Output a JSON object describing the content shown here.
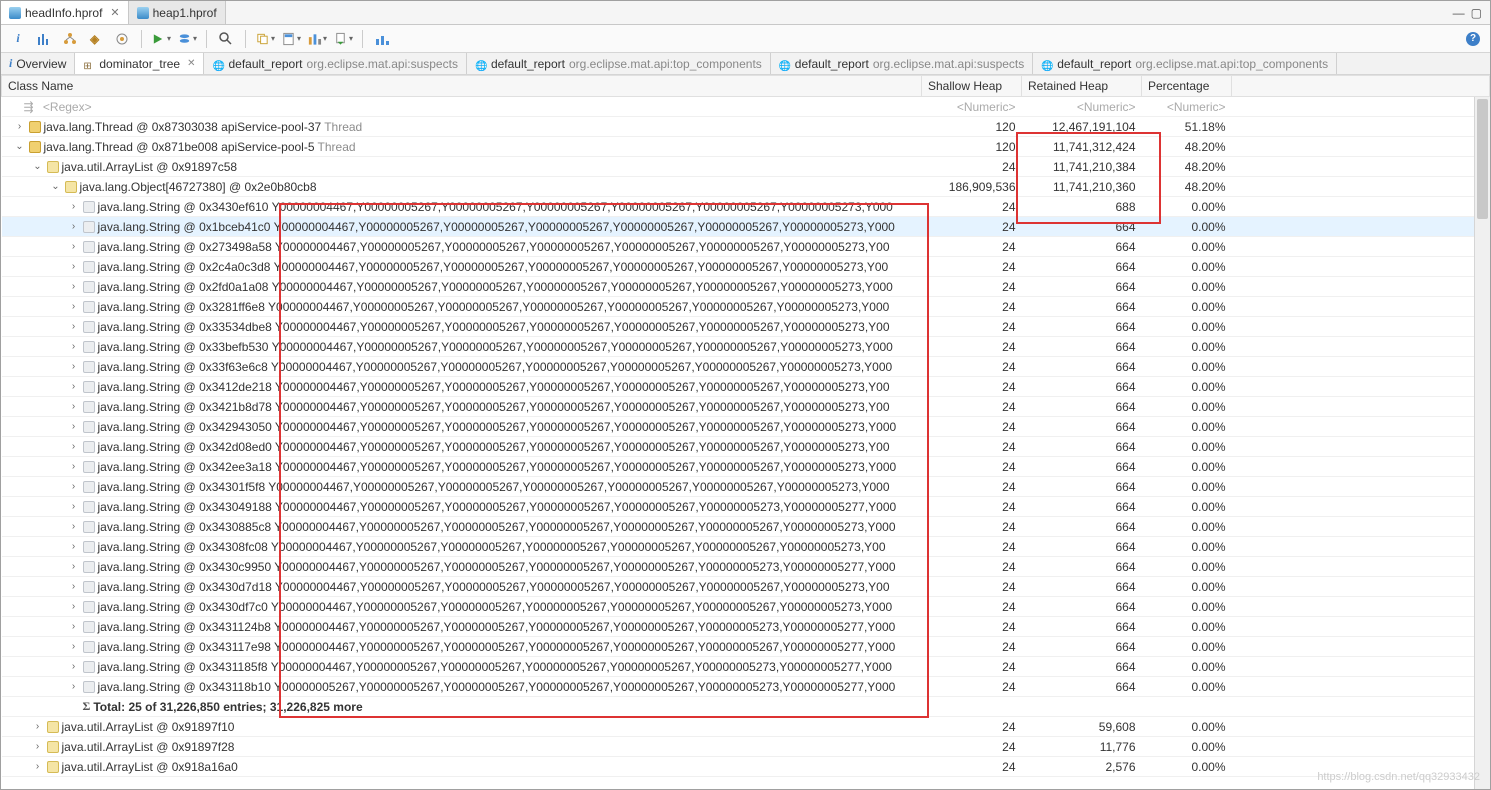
{
  "editorTabs": [
    {
      "label": "heap1.hprof",
      "active": false
    },
    {
      "label": "headInfo.hprof",
      "active": true
    }
  ],
  "subTabs": [
    {
      "icon": "info",
      "label": "Overview",
      "active": false
    },
    {
      "icon": "tree",
      "label": "dominator_tree",
      "active": true
    },
    {
      "icon": "globe",
      "label": "default_report",
      "scope": "org.eclipse.mat.api:suspects",
      "active": false
    },
    {
      "icon": "globe",
      "label": "default_report",
      "scope": "org.eclipse.mat.api:top_components",
      "active": false
    },
    {
      "icon": "globe",
      "label": "default_report",
      "scope": "org.eclipse.mat.api:suspects",
      "active": false
    },
    {
      "icon": "globe",
      "label": "default_report",
      "scope": "org.eclipse.mat.api:top_components",
      "active": false
    }
  ],
  "columns": {
    "name": "Class Name",
    "shallow": "Shallow Heap",
    "retained": "Retained Heap",
    "pct": "Percentage"
  },
  "filters": {
    "name": "<Regex>",
    "num": "<Numeric>"
  },
  "rows": [
    {
      "depth": 0,
      "arrow": "closed",
      "ico": "thread",
      "label": "java.lang.Thread @ 0x87303038  apiService-pool-37",
      "suffix": "Thread",
      "shallow": "120",
      "retained": "12,467,191,104",
      "pct": "51.18%"
    },
    {
      "depth": 0,
      "arrow": "open",
      "ico": "thread",
      "label": "java.lang.Thread @ 0x871be008  apiService-pool-5",
      "suffix": "Thread",
      "shallow": "120",
      "retained": "11,741,312,424",
      "pct": "48.20%"
    },
    {
      "depth": 1,
      "arrow": "open",
      "ico": "cls",
      "label": "java.util.ArrayList @ 0x91897c58",
      "shallow": "24",
      "retained": "11,741,210,384",
      "pct": "48.20%"
    },
    {
      "depth": 2,
      "arrow": "open",
      "ico": "cls",
      "label": "java.lang.Object[46727380] @ 0x2e0b80cb8",
      "shallow": "186,909,536",
      "retained": "11,741,210,360",
      "pct": "48.20%"
    },
    {
      "depth": 3,
      "arrow": "closed",
      "ico": "file",
      "label": "java.lang.String @ 0x3430ef610   Y00000004467,Y00000005267,Y00000005267,Y00000005267,Y00000005267,Y00000005267,Y00000005273,Y000",
      "shallow": "24",
      "retained": "688",
      "pct": "0.00%"
    },
    {
      "depth": 3,
      "arrow": "closed",
      "ico": "file",
      "label": "java.lang.String @ 0x1bceb41c0   Y00000004467,Y00000005267,Y00000005267,Y00000005267,Y00000005267,Y00000005267,Y00000005273,Y000",
      "shallow": "24",
      "retained": "664",
      "pct": "0.00%",
      "selected": true
    },
    {
      "depth": 3,
      "arrow": "closed",
      "ico": "file",
      "label": "java.lang.String @ 0x273498a58   Y00000004467,Y00000005267,Y00000005267,Y00000005267,Y00000005267,Y00000005267,Y00000005273,Y00",
      "shallow": "24",
      "retained": "664",
      "pct": "0.00%"
    },
    {
      "depth": 3,
      "arrow": "closed",
      "ico": "file",
      "label": "java.lang.String @ 0x2c4a0c3d8   Y00000004467,Y00000005267,Y00000005267,Y00000005267,Y00000005267,Y00000005267,Y00000005273,Y00",
      "shallow": "24",
      "retained": "664",
      "pct": "0.00%"
    },
    {
      "depth": 3,
      "arrow": "closed",
      "ico": "file",
      "label": "java.lang.String @ 0x2fd0a1a08   Y00000004467,Y00000005267,Y00000005267,Y00000005267,Y00000005267,Y00000005267,Y00000005273,Y000",
      "shallow": "24",
      "retained": "664",
      "pct": "0.00%"
    },
    {
      "depth": 3,
      "arrow": "closed",
      "ico": "file",
      "label": "java.lang.String @ 0x3281ff6e8   Y00000004467,Y00000005267,Y00000005267,Y00000005267,Y00000005267,Y00000005267,Y00000005273,Y000",
      "shallow": "24",
      "retained": "664",
      "pct": "0.00%"
    },
    {
      "depth": 3,
      "arrow": "closed",
      "ico": "file",
      "label": "java.lang.String @ 0x33534dbe8   Y00000004467,Y00000005267,Y00000005267,Y00000005267,Y00000005267,Y00000005267,Y00000005273,Y00",
      "shallow": "24",
      "retained": "664",
      "pct": "0.00%"
    },
    {
      "depth": 3,
      "arrow": "closed",
      "ico": "file",
      "label": "java.lang.String @ 0x33befb530   Y00000004467,Y00000005267,Y00000005267,Y00000005267,Y00000005267,Y00000005267,Y00000005273,Y000",
      "shallow": "24",
      "retained": "664",
      "pct": "0.00%"
    },
    {
      "depth": 3,
      "arrow": "closed",
      "ico": "file",
      "label": "java.lang.String @ 0x33f63e6c8   Y00000004467,Y00000005267,Y00000005267,Y00000005267,Y00000005267,Y00000005267,Y00000005273,Y000",
      "shallow": "24",
      "retained": "664",
      "pct": "0.00%"
    },
    {
      "depth": 3,
      "arrow": "closed",
      "ico": "file",
      "label": "java.lang.String @ 0x3412de218   Y00000004467,Y00000005267,Y00000005267,Y00000005267,Y00000005267,Y00000005267,Y00000005273,Y00",
      "shallow": "24",
      "retained": "664",
      "pct": "0.00%"
    },
    {
      "depth": 3,
      "arrow": "closed",
      "ico": "file",
      "label": "java.lang.String @ 0x3421b8d78   Y00000004467,Y00000005267,Y00000005267,Y00000005267,Y00000005267,Y00000005267,Y00000005273,Y00",
      "shallow": "24",
      "retained": "664",
      "pct": "0.00%"
    },
    {
      "depth": 3,
      "arrow": "closed",
      "ico": "file",
      "label": "java.lang.String @ 0x342943050   Y00000004467,Y00000005267,Y00000005267,Y00000005267,Y00000005267,Y00000005267,Y00000005273,Y000",
      "shallow": "24",
      "retained": "664",
      "pct": "0.00%"
    },
    {
      "depth": 3,
      "arrow": "closed",
      "ico": "file",
      "label": "java.lang.String @ 0x342d08ed0   Y00000004467,Y00000005267,Y00000005267,Y00000005267,Y00000005267,Y00000005267,Y00000005273,Y00",
      "shallow": "24",
      "retained": "664",
      "pct": "0.00%"
    },
    {
      "depth": 3,
      "arrow": "closed",
      "ico": "file",
      "label": "java.lang.String @ 0x342ee3a18   Y00000004467,Y00000005267,Y00000005267,Y00000005267,Y00000005267,Y00000005267,Y00000005273,Y000",
      "shallow": "24",
      "retained": "664",
      "pct": "0.00%"
    },
    {
      "depth": 3,
      "arrow": "closed",
      "ico": "file",
      "label": "java.lang.String @ 0x34301f5f8   Y00000004467,Y00000005267,Y00000005267,Y00000005267,Y00000005267,Y00000005267,Y00000005273,Y000",
      "shallow": "24",
      "retained": "664",
      "pct": "0.00%"
    },
    {
      "depth": 3,
      "arrow": "closed",
      "ico": "file",
      "label": "java.lang.String @ 0x343049188   Y00000004467,Y00000005267,Y00000005267,Y00000005267,Y00000005267,Y00000005273,Y00000005277,Y000",
      "shallow": "24",
      "retained": "664",
      "pct": "0.00%"
    },
    {
      "depth": 3,
      "arrow": "closed",
      "ico": "file",
      "label": "java.lang.String @ 0x3430885c8   Y00000004467,Y00000005267,Y00000005267,Y00000005267,Y00000005267,Y00000005267,Y00000005273,Y000",
      "shallow": "24",
      "retained": "664",
      "pct": "0.00%"
    },
    {
      "depth": 3,
      "arrow": "closed",
      "ico": "file",
      "label": "java.lang.String @ 0x34308fc08   Y00000004467,Y00000005267,Y00000005267,Y00000005267,Y00000005267,Y00000005267,Y00000005273,Y00",
      "shallow": "24",
      "retained": "664",
      "pct": "0.00%"
    },
    {
      "depth": 3,
      "arrow": "closed",
      "ico": "file",
      "label": "java.lang.String @ 0x3430c9950   Y00000004467,Y00000005267,Y00000005267,Y00000005267,Y00000005267,Y00000005273,Y00000005277,Y000",
      "shallow": "24",
      "retained": "664",
      "pct": "0.00%"
    },
    {
      "depth": 3,
      "arrow": "closed",
      "ico": "file",
      "label": "java.lang.String @ 0x3430d7d18   Y00000004467,Y00000005267,Y00000005267,Y00000005267,Y00000005267,Y00000005267,Y00000005273,Y00",
      "shallow": "24",
      "retained": "664",
      "pct": "0.00%"
    },
    {
      "depth": 3,
      "arrow": "closed",
      "ico": "file",
      "label": "java.lang.String @ 0x3430df7c0   Y00000004467,Y00000005267,Y00000005267,Y00000005267,Y00000005267,Y00000005267,Y00000005273,Y000",
      "shallow": "24",
      "retained": "664",
      "pct": "0.00%"
    },
    {
      "depth": 3,
      "arrow": "closed",
      "ico": "file",
      "label": "java.lang.String @ 0x3431124b8   Y00000004467,Y00000005267,Y00000005267,Y00000005267,Y00000005267,Y00000005273,Y00000005277,Y000",
      "shallow": "24",
      "retained": "664",
      "pct": "0.00%"
    },
    {
      "depth": 3,
      "arrow": "closed",
      "ico": "file",
      "label": "java.lang.String @ 0x343117e98   Y00000004467,Y00000005267,Y00000005267,Y00000005267,Y00000005267,Y00000005267,Y00000005277,Y000",
      "shallow": "24",
      "retained": "664",
      "pct": "0.00%"
    },
    {
      "depth": 3,
      "arrow": "closed",
      "ico": "file",
      "label": "java.lang.String @ 0x3431185f8   Y00000004467,Y00000005267,Y00000005267,Y00000005267,Y00000005267,Y00000005273,Y00000005277,Y000",
      "shallow": "24",
      "retained": "664",
      "pct": "0.00%"
    },
    {
      "depth": 3,
      "arrow": "closed",
      "ico": "file",
      "label": "java.lang.String @ 0x343118b10   Y00000005267,Y00000005267,Y00000005267,Y00000005267,Y00000005267,Y00000005273,Y00000005277,Y000",
      "shallow": "24",
      "retained": "664",
      "pct": "0.00%"
    },
    {
      "depth": 3,
      "arrow": "none",
      "ico": "sigma",
      "label": "Total: 25 of 31,226,850 entries; 31,226,825 more",
      "bold": true
    },
    {
      "depth": 1,
      "arrow": "closed",
      "ico": "cls",
      "label": "java.util.ArrayList @ 0x91897f10",
      "shallow": "24",
      "retained": "59,608",
      "pct": "0.00%"
    },
    {
      "depth": 1,
      "arrow": "closed",
      "ico": "cls",
      "label": "java.util.ArrayList @ 0x91897f28",
      "shallow": "24",
      "retained": "11,776",
      "pct": "0.00%"
    },
    {
      "depth": 1,
      "arrow": "closed",
      "ico": "cls",
      "label": "java.util.ArrayList @ 0x918a16a0",
      "shallow": "24",
      "retained": "2,576",
      "pct": "0.00%"
    }
  ],
  "watermark": "https://blog.csdn.net/qq32933432"
}
